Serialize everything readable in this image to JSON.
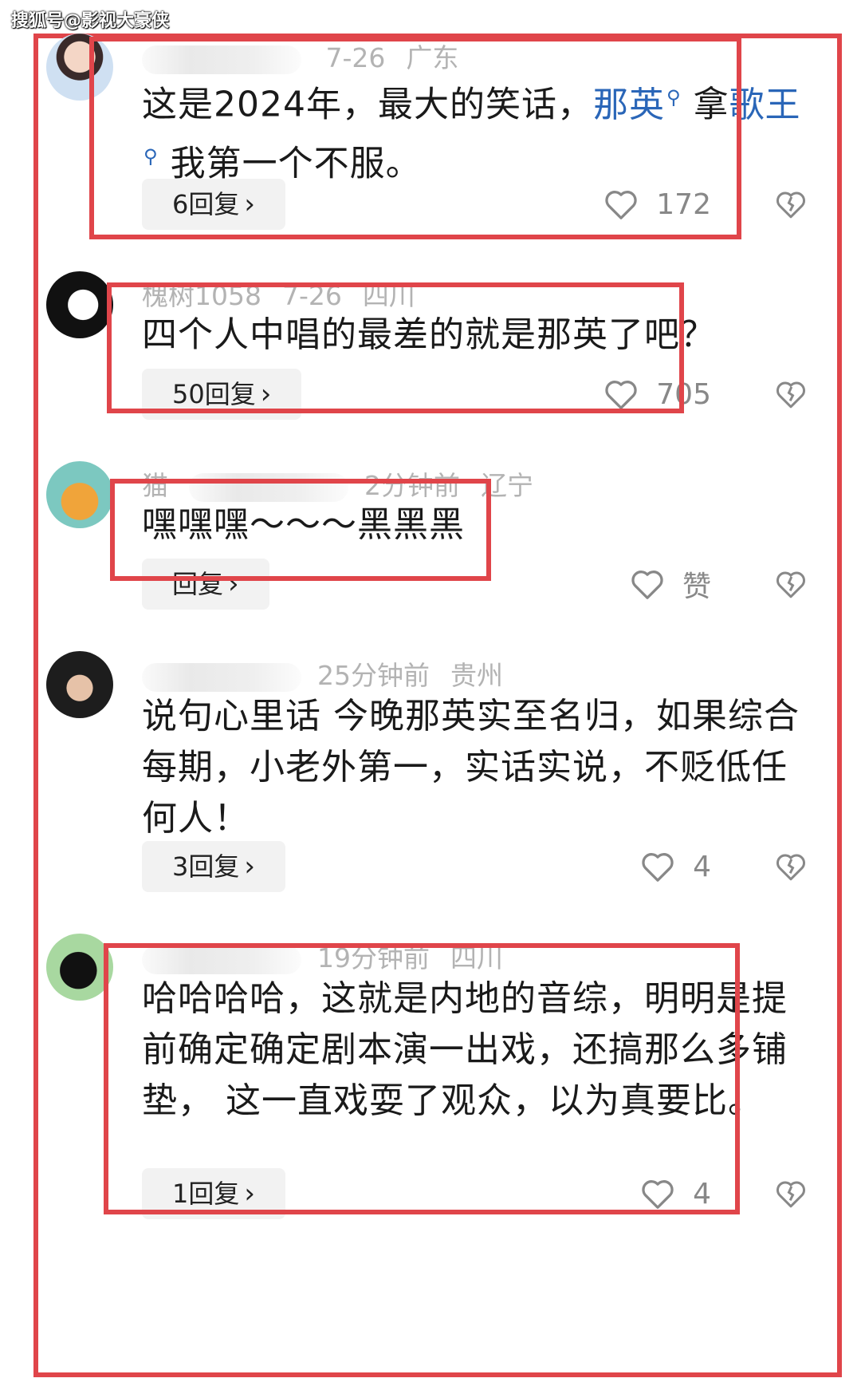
{
  "watermark": "搜狐号@影视大豪侠",
  "comments": [
    {
      "meta": [
        "7-26",
        "广东"
      ],
      "text_parts": [
        "这是2024年，最大的笑话，",
        "那英",
        "拿",
        "歌王",
        "我第一个不服。"
      ],
      "reply_label": "6回复",
      "like_count": "172"
    },
    {
      "meta": [
        "槐树1058",
        "7-26",
        "四川"
      ],
      "text": "四个人中唱的最差的就是那英了吧？",
      "reply_label": "50回复",
      "like_count": "705"
    },
    {
      "meta": [
        "猫",
        "2分钟前",
        "辽宁"
      ],
      "text": "嘿嘿嘿～～～黑黑黑",
      "reply_label": "回复",
      "like_count": "赞"
    },
    {
      "meta": [
        "25分钟前",
        "贵州"
      ],
      "text": "说句心里话 今晚那英实至名归，如果综合每期，小老外第一，实话实说，不贬低任何人！",
      "reply_label": "3回复",
      "like_count": "4"
    },
    {
      "meta": [
        "19分钟前",
        "四川"
      ],
      "text": "哈哈哈哈，这就是内地的音综，明明是提前确定确定剧本演一出戏，还搞那么多铺垫， 这一直戏耍了观众，以为真要比。",
      "reply_label": "1回复",
      "like_count": "4"
    }
  ],
  "colors": {
    "highlight_frame": "#e0454a",
    "hashtag": "#2a66b8",
    "reply_button_bg": "#f2f2f2"
  },
  "icons": [
    "heart-icon",
    "broken-heart-icon",
    "chevron-right-icon",
    "search-icon"
  ]
}
